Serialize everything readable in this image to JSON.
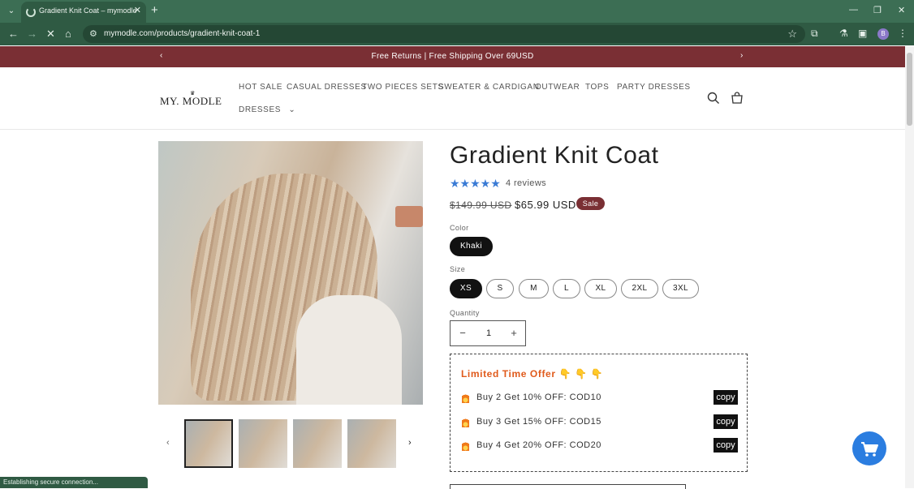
{
  "browser": {
    "tab_title": "Gradient Knit Coat – mymodle",
    "tab_close": "✕",
    "new_tab": "+",
    "tab_menu_icon": "chevron-down",
    "url": "mymodle.com/products/gradient-knit-coat-1",
    "profile_initial": "B",
    "status": "Establishing secure connection..."
  },
  "announcement": {
    "text": "Free Returns | Free Shipping Over 69USD"
  },
  "header": {
    "logo": "MY. MODLE",
    "nav": [
      "HOT SALE",
      "CASUAL DRESSES",
      "TWO PIECES SETS",
      "SWEATER & CARDIGAN",
      "OUTWEAR",
      "TOPS",
      "PARTY DRESSES",
      "DRESSES"
    ]
  },
  "product": {
    "title": "Gradient Knit Coat",
    "rating_stars": "★★★★★",
    "rating": 5,
    "reviews": "4 reviews",
    "price_old": "$149.99 USD",
    "price_new": "$65.99 USD",
    "sale_badge": "Sale",
    "color_label": "Color",
    "color_options": [
      "Khaki"
    ],
    "color_selected": "Khaki",
    "size_label": "Size",
    "sizes": [
      "XS",
      "S",
      "M",
      "L",
      "XL",
      "2XL",
      "3XL"
    ],
    "size_selected": "XS",
    "quantity_label": "Quantity",
    "quantity": "1",
    "qty_minus": "−",
    "qty_plus": "+"
  },
  "offer": {
    "title": "Limited Time Offer 👇 👇 👇",
    "items": [
      {
        "text": "Buy 2 Get 10% OFF: COD10",
        "button": "copy"
      },
      {
        "text": "Buy 3 Get 15% OFF: COD15",
        "button": "copy"
      },
      {
        "text": "Buy 4 Get 20% OFF: COD20",
        "button": "copy"
      }
    ]
  },
  "colors": {
    "browser_tab_bar": "#3c6e54",
    "announcement_bg": "#7a2f34",
    "offer_title": "#e05a1b",
    "star": "#3a7bd5",
    "cart_fab": "#2b7de0"
  }
}
